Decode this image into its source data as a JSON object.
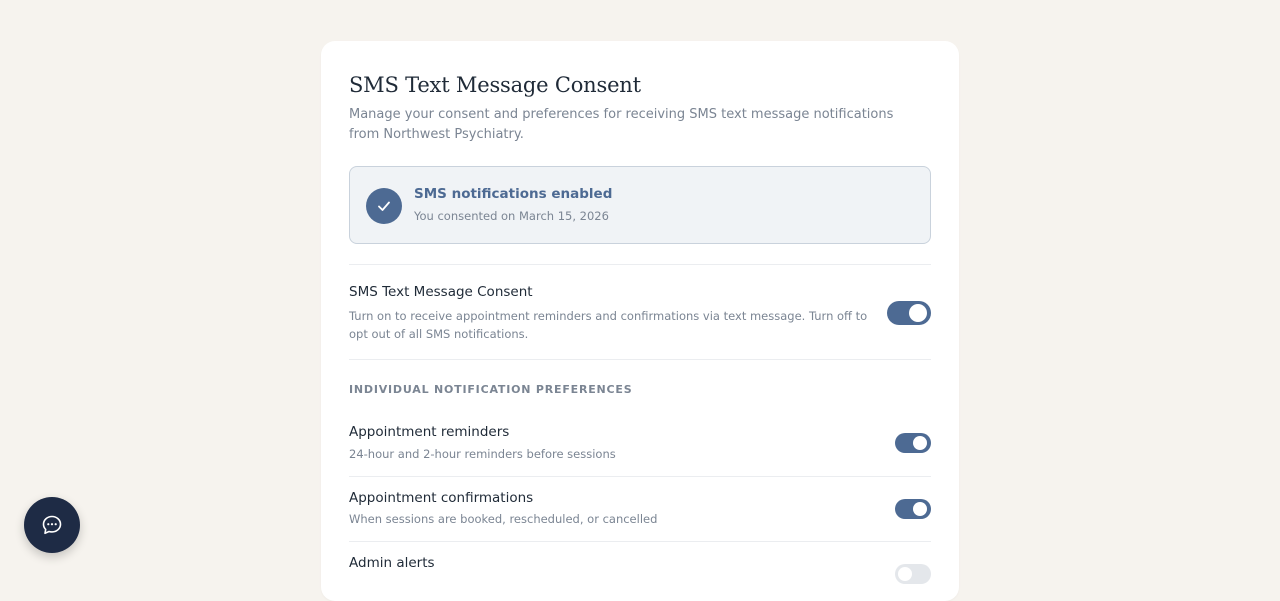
{
  "page": {
    "title": "SMS Text Message Consent",
    "subtitle": "Manage your consent and preferences for receiving SMS text message notifications from Northwest Psychiatry."
  },
  "status": {
    "title": "SMS notifications enabled",
    "detail": "You consented on March 15, 2026",
    "icon": "check-icon"
  },
  "consent": {
    "title": "SMS Text Message Consent",
    "description": "Turn on to receive appointment reminders and confirmations via text message. Turn off to opt out of all SMS notifications.",
    "enabled": true
  },
  "preferences": {
    "section_label": "INDIVIDUAL NOTIFICATION PREFERENCES",
    "items": [
      {
        "title": "Appointment reminders",
        "description": "24-hour and 2-hour reminders before sessions",
        "enabled": true
      },
      {
        "title": "Appointment confirmations",
        "description": "When sessions are booked, rescheduled, or cancelled",
        "enabled": true
      },
      {
        "title": "Admin alerts",
        "description": "",
        "enabled": false
      }
    ]
  },
  "chat": {
    "icon": "chat-bubble-icon"
  },
  "colors": {
    "accent": "#4d6a93",
    "background": "#f6f3ee",
    "chat_button": "#1e2b45"
  }
}
